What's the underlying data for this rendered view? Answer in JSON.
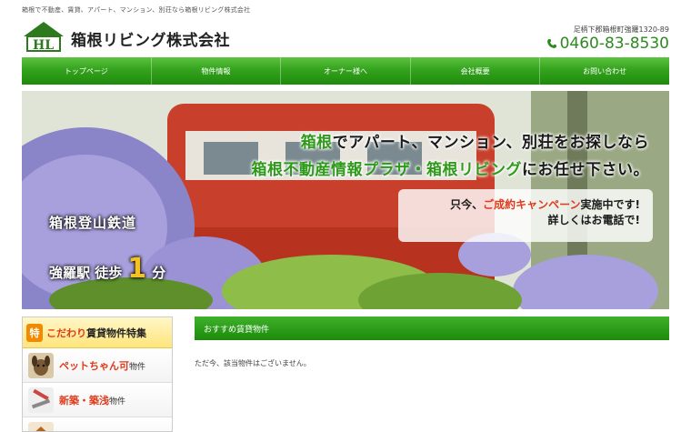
{
  "header": {
    "tagline": "箱根で不動産、賃貸、アパート、マンション、別荘なら箱根リビング株式会社",
    "company_name": "箱根リビング株式会社",
    "address": "足柄下郡箱根町強羅1320-89",
    "phone": "0460-83-8530",
    "logo_icon": "house-logo-icon",
    "accent_color": "#2d8a1f"
  },
  "nav": {
    "items": [
      {
        "label": "トップページ"
      },
      {
        "label": "物件情報"
      },
      {
        "label": "オーナー様へ"
      },
      {
        "label": "会社概要"
      },
      {
        "label": "お問い合わせ"
      }
    ]
  },
  "hero": {
    "line1_a": "箱根",
    "line1_b": "でアパート、マンション、別荘をお探しなら",
    "line2_a": "箱根不動産情報プラザ・箱根リビング",
    "line2_b": "にお任せ下さい。",
    "campaign_a": "只今、",
    "campaign_b": "ご成約キャンペーン",
    "campaign_c": "実施中です!",
    "campaign_line2": "詳しくはお電話で!",
    "station_line1": "箱根登山鉄道",
    "station_name": "強羅駅 徒歩",
    "station_minutes": "1",
    "station_unit": "分"
  },
  "sidebar": {
    "badge": "特",
    "title_a": "こだわり",
    "title_b": "賃貸物件特集",
    "items": [
      {
        "highlight": "ペットちゃん可",
        "suffix": "物件",
        "icon": "dog-icon"
      },
      {
        "highlight": "新築・築浅",
        "suffix": "物件",
        "icon": "tools-icon"
      },
      {
        "highlight": "",
        "suffix": "",
        "icon": "house-icon"
      }
    ]
  },
  "main": {
    "section_title": "おすすめ賃貸物件",
    "empty_message": "ただ今、該当物件はございません。"
  }
}
